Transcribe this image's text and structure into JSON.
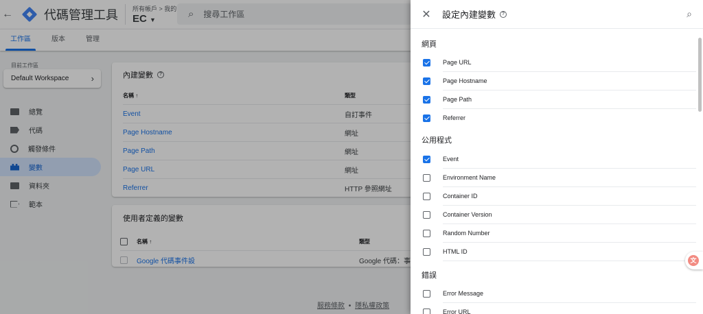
{
  "header": {
    "back_icon": "arrow-back-icon",
    "app_title": "代碼管理工具",
    "breadcrumb": "所有帳戶 > 我的公司",
    "container": "EC",
    "search_placeholder": "搜尋工作區"
  },
  "tabs": [
    {
      "label": "工作區",
      "active": true
    },
    {
      "label": "版本",
      "active": false
    },
    {
      "label": "管理",
      "active": false
    }
  ],
  "sidebar": {
    "workspace_label": "目前工作區",
    "workspace_name": "Default Workspace",
    "items": [
      {
        "label": "總覽",
        "icon": "folder-icon"
      },
      {
        "label": "代碼",
        "icon": "tag-icon"
      },
      {
        "label": "觸發條件",
        "icon": "trigger-icon"
      },
      {
        "label": "變數",
        "icon": "variables-icon",
        "active": true
      },
      {
        "label": "資料夾",
        "icon": "folder-icon"
      },
      {
        "label": "範本",
        "icon": "template-icon"
      }
    ]
  },
  "builtin_card": {
    "title": "內建變數",
    "col_name": "名稱 ↑",
    "col_type": "類型",
    "rows": [
      {
        "name": "Event",
        "type": "自訂事件"
      },
      {
        "name": "Page Hostname",
        "type": "網址"
      },
      {
        "name": "Page Path",
        "type": "網址"
      },
      {
        "name": "Page URL",
        "type": "網址"
      },
      {
        "name": "Referrer",
        "type": "HTTP 參照網址"
      }
    ]
  },
  "user_card": {
    "title": "使用者定義的變數",
    "col_name": "名稱 ↑",
    "col_type": "類型",
    "rows": [
      {
        "name": "Google 代碼事件設",
        "type": "Google 代碼：事件"
      }
    ]
  },
  "footer": {
    "terms": "服務條款",
    "sep": "•",
    "privacy": "隱私權政策"
  },
  "panel": {
    "title": "設定內建變數",
    "close_icon": "close-icon",
    "search_icon": "search-icon",
    "sections": [
      {
        "title": "網頁",
        "options": [
          {
            "label": "Page URL",
            "checked": true
          },
          {
            "label": "Page Hostname",
            "checked": true
          },
          {
            "label": "Page Path",
            "checked": true
          },
          {
            "label": "Referrer",
            "checked": true
          }
        ]
      },
      {
        "title": "公用程式",
        "options": [
          {
            "label": "Event",
            "checked": true
          },
          {
            "label": "Environment Name",
            "checked": false
          },
          {
            "label": "Container ID",
            "checked": false
          },
          {
            "label": "Container Version",
            "checked": false
          },
          {
            "label": "Random Number",
            "checked": false
          },
          {
            "label": "HTML ID",
            "checked": false
          }
        ]
      },
      {
        "title": "錯誤",
        "options": [
          {
            "label": "Error Message",
            "checked": false
          },
          {
            "label": "Error URL",
            "checked": false
          }
        ]
      }
    ]
  },
  "colors": {
    "accent": "#1a73e8",
    "nav_active_bg": "#d2e3fc"
  }
}
